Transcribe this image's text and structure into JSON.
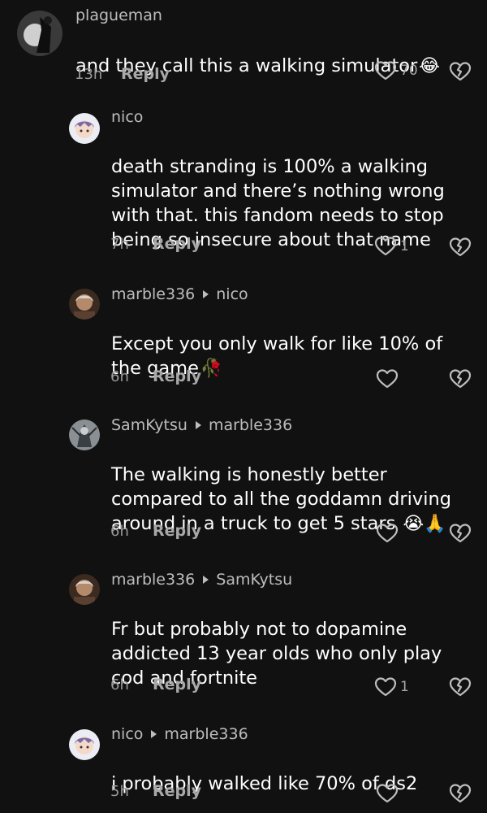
{
  "comments": [
    {
      "username": "plagueman",
      "reply_to": "",
      "text": "and they call this a walking simulator",
      "emoji": "😂",
      "time": "13h",
      "reply_label": "Reply",
      "likes": "70",
      "avatar_icon": "dark-figure-avatar"
    },
    {
      "username": "nico",
      "reply_to": "",
      "text": "death stranding is 100% a walking\nsimulator and there’s nothing wrong\nwith that. this fandom needs to stop\nbeing so insecure about that name",
      "emoji": "",
      "time": "7h",
      "reply_label": "Reply",
      "likes": "1",
      "avatar_icon": "anime-girl-avatar"
    },
    {
      "username": "marble336",
      "reply_to": "nico",
      "text": "Except you only walk for like 10% of\nthe game",
      "emoji": "🥀",
      "time": "6h",
      "reply_label": "Reply",
      "likes": "",
      "avatar_icon": "old-man-avatar"
    },
    {
      "username": "SamKytsu",
      "reply_to": "marble336",
      "text": "The walking is honestly better\ncompared to all the goddamn driving\naround in a truck to get 5 stars",
      "emoji": "😭🙏",
      "time": "6h",
      "reply_label": "Reply",
      "likes": "",
      "avatar_icon": "ghost-character-avatar"
    },
    {
      "username": "marble336",
      "reply_to": "SamKytsu",
      "text": "Fr but probably not to dopamine\naddicted 13 year olds who only play\ncod and fortnite",
      "emoji": "",
      "time": "6h",
      "reply_label": "Reply",
      "likes": "1",
      "avatar_icon": "old-man-avatar"
    },
    {
      "username": "nico",
      "reply_to": "marble336",
      "text": "i probably walked like 70% of ds2",
      "emoji": "",
      "time": "5h",
      "reply_label": "Reply",
      "likes": "",
      "avatar_icon": "anime-girl-avatar"
    }
  ],
  "colors": {
    "background": "#111111",
    "text": "#ffffff",
    "meta": "#bdbdbd",
    "muted": "#a8a8a8"
  }
}
